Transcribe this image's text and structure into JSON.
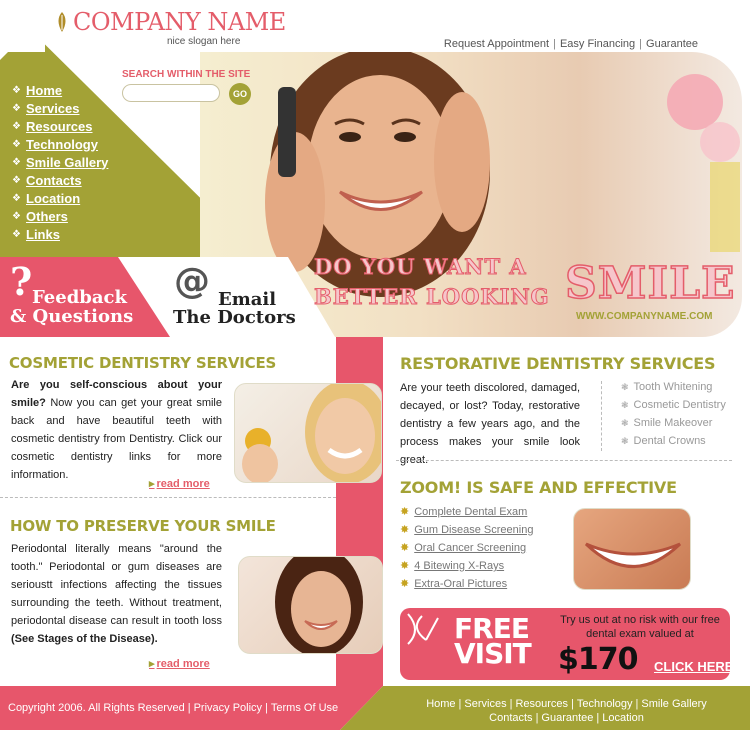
{
  "header": {
    "company_name": "COMPANY NAME",
    "slogan": "nice slogan here",
    "top_links": [
      "Request Appointment",
      "Easy Financing",
      "Guarantee"
    ]
  },
  "search": {
    "label": "SEARCH WITHIN THE SITE",
    "placeholder": "",
    "go_label": "GO"
  },
  "nav": {
    "items": [
      "Home",
      "Services",
      "Resources",
      "Technology",
      "Smile Gallery",
      "Contacts",
      "Location",
      "Others",
      "Links"
    ]
  },
  "promo": {
    "feedback_line1": "Feedback",
    "feedback_line2": "& Questions",
    "email_line1": "Email",
    "email_line2": "The Doctors"
  },
  "hero": {
    "line1": "DO YOU WANT A",
    "line2": "BETTER LOOKING",
    "big_word": "SMILE",
    "url": "WWW.COMPANYNAME.COM"
  },
  "cosmetic": {
    "title": "COSMETIC DENTISTRY SERVICES",
    "lead": "Are you self-conscious about your smile?",
    "body": " Now you can get your great smile back and have beautiful teeth with cosmetic dentistry from Dentistry. Click our cosmetic dentistry links for more information.",
    "read_more": "read more"
  },
  "preserve": {
    "title": "HOW TO PRESERVE YOUR SMILE",
    "body": "Periodontal literally means \"around the tooth.\" Periodontal or gum diseases are serioustt infections affecting the tissues surrounding the teeth. Without treatment, periodontal disease can result in tooth loss ",
    "bold_tail": "(See Stages of the Disease).",
    "read_more": "read more"
  },
  "restorative": {
    "title": "RESTORATIVE DENTISTRY SERVICES",
    "body": "Are your teeth discolored, damaged, decayed, or lost? Today, restorative dentistry a few years ago, and the process makes your smile look great.",
    "services": [
      "Tooth Whitening",
      "Cosmetic Dentistry",
      "Smile Makeover",
      "Dental Crowns"
    ]
  },
  "zoom": {
    "title": "ZOOM! IS SAFE AND EFFECTIVE",
    "items": [
      "Complete Dental Exam",
      "Gum Disease Screening",
      "Oral Cancer Screening",
      "4 Bitewing X-Rays",
      "Extra-Oral Pictures"
    ]
  },
  "free_visit": {
    "title_line1": "FREE",
    "title_line2": "VISIT",
    "text": "Try us out at no risk with our free dental exam valued at",
    "price": "$170",
    "cta": "CLICK HERE"
  },
  "footer": {
    "copyright": "Copyright 2006. All Rights Reserved",
    "links_left": [
      "Privacy Policy",
      "Terms Of Use"
    ],
    "links_row1": [
      "Home",
      "Services",
      "Resources",
      "Technology",
      "Smile Gallery"
    ],
    "links_row2": [
      "Contacts",
      "Guarantee",
      "Location"
    ]
  },
  "colors": {
    "olive": "#a3a236",
    "pink": "#e7566b",
    "text": "#333333"
  }
}
